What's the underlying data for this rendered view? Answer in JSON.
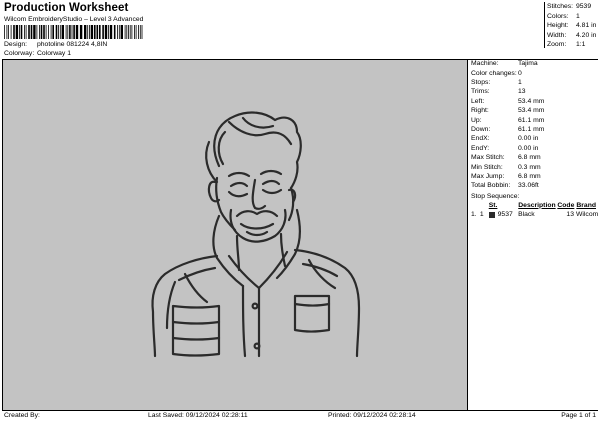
{
  "header": {
    "title": "Production Worksheet",
    "subtitle": "Wilcom EmbroideryStudio – Level 3 Advanced",
    "design_label": "Design:",
    "design_value": "photoline 081224 4,8IN",
    "colorway_label": "Colorway:",
    "colorway_value": "Colorway 1"
  },
  "stats": [
    {
      "label": "Stitches:",
      "value": "9539"
    },
    {
      "label": "Colors:",
      "value": "1"
    },
    {
      "label": "Height:",
      "value": "4.81 in"
    },
    {
      "label": "Width:",
      "value": "4.20 in"
    },
    {
      "label": "Zoom:",
      "value": "1:1"
    }
  ],
  "machine": [
    {
      "label": "Machine:",
      "value": "Tajima"
    },
    {
      "label": "Color changes:",
      "value": "0"
    },
    {
      "label": "Stops:",
      "value": "1"
    },
    {
      "label": "Trims:",
      "value": "13"
    },
    {
      "label": "Left:",
      "value": "53.4 mm"
    },
    {
      "label": "Right:",
      "value": "53.4 mm"
    },
    {
      "label": "Up:",
      "value": "61.1 mm"
    },
    {
      "label": "Down:",
      "value": "61.1 mm"
    },
    {
      "label": "EndX:",
      "value": "0.00 in"
    },
    {
      "label": "EndY:",
      "value": "0.00 in"
    },
    {
      "label": "Max Stitch:",
      "value": "6.8 mm"
    },
    {
      "label": "Min Stitch:",
      "value": "0.3 mm"
    },
    {
      "label": "Max Jump:",
      "value": "6.8 mm"
    },
    {
      "label": "Total Bobbin:",
      "value": "33.06ft"
    }
  ],
  "stop_sequence": {
    "heading": "Stop Sequence:",
    "columns": {
      "st": "St.",
      "description": "Description",
      "code": "Code",
      "brand": "Brand"
    },
    "rows": [
      {
        "index": "1.",
        "n": "1",
        "color": "#2b2b2b",
        "st": "9537",
        "description": "Black",
        "code": "13",
        "brand": "Wilcom"
      }
    ]
  },
  "footer": {
    "created": "Created By:",
    "saved": "Last Saved: 09/12/2024 02:28:11",
    "printed": "Printed: 09/12/2024 02:28:14",
    "page": "Page 1 of 1"
  },
  "colors": {
    "canvas": "#c3c3c3",
    "thread": "#2b2b2b"
  }
}
